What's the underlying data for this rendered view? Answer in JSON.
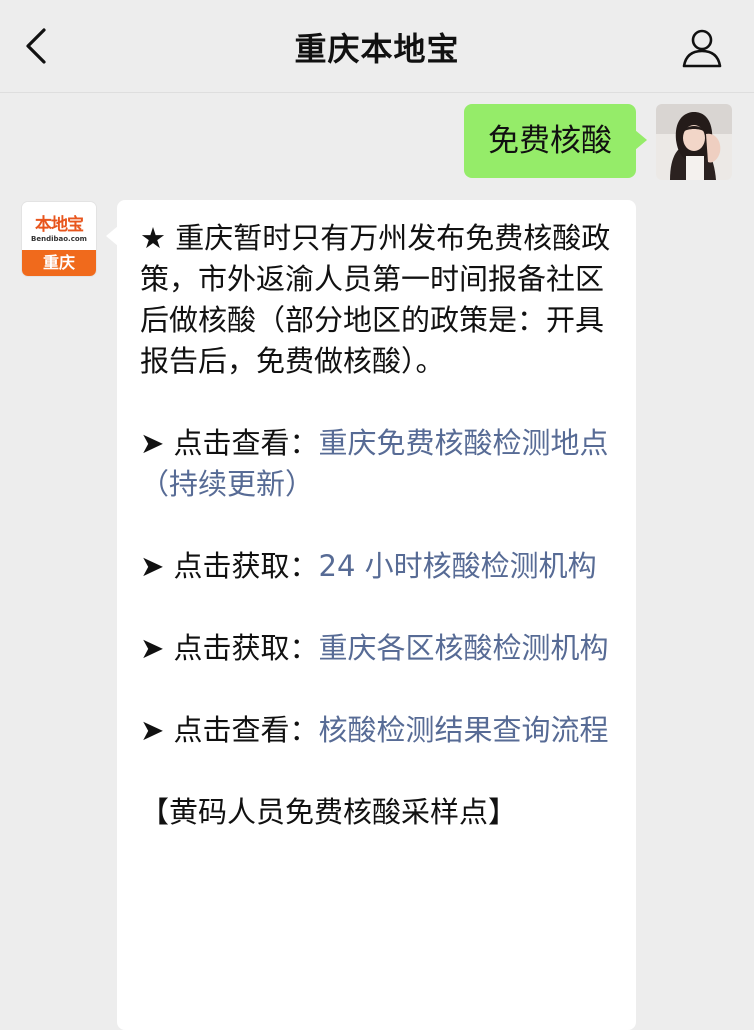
{
  "header": {
    "title": "重庆本地宝"
  },
  "outgoing": {
    "text": "免费核酸"
  },
  "bot": {
    "logo_name": "本地宝",
    "logo_url": "Bendibao.com",
    "logo_city": "重庆"
  },
  "message": {
    "intro": "★ 重庆暂时只有万州发布免费核酸政策，市外返渝人员第一时间报备社区后做核酸（部分地区的政策是：开具报告后，免费做核酸）。",
    "items": [
      {
        "prefix": "➤ 点击查看：",
        "link": "重庆免费核酸检测地点（持续更新）"
      },
      {
        "prefix": "➤ 点击获取：",
        "link": "24 小时核酸检测机构"
      },
      {
        "prefix": "➤ 点击获取：",
        "link": "重庆各区核酸检测机构"
      },
      {
        "prefix": "➤ 点击查看：",
        "link": "核酸检测结果查询流程"
      }
    ],
    "footer": "【黄码人员免费核酸采样点】"
  },
  "colors": {
    "background": "#ededed",
    "bubble_out": "#95ec69",
    "link": "#576b95",
    "brand_orange": "#f06a1c"
  },
  "icons": {
    "back": "chevron-left-icon",
    "profile": "person-icon"
  }
}
